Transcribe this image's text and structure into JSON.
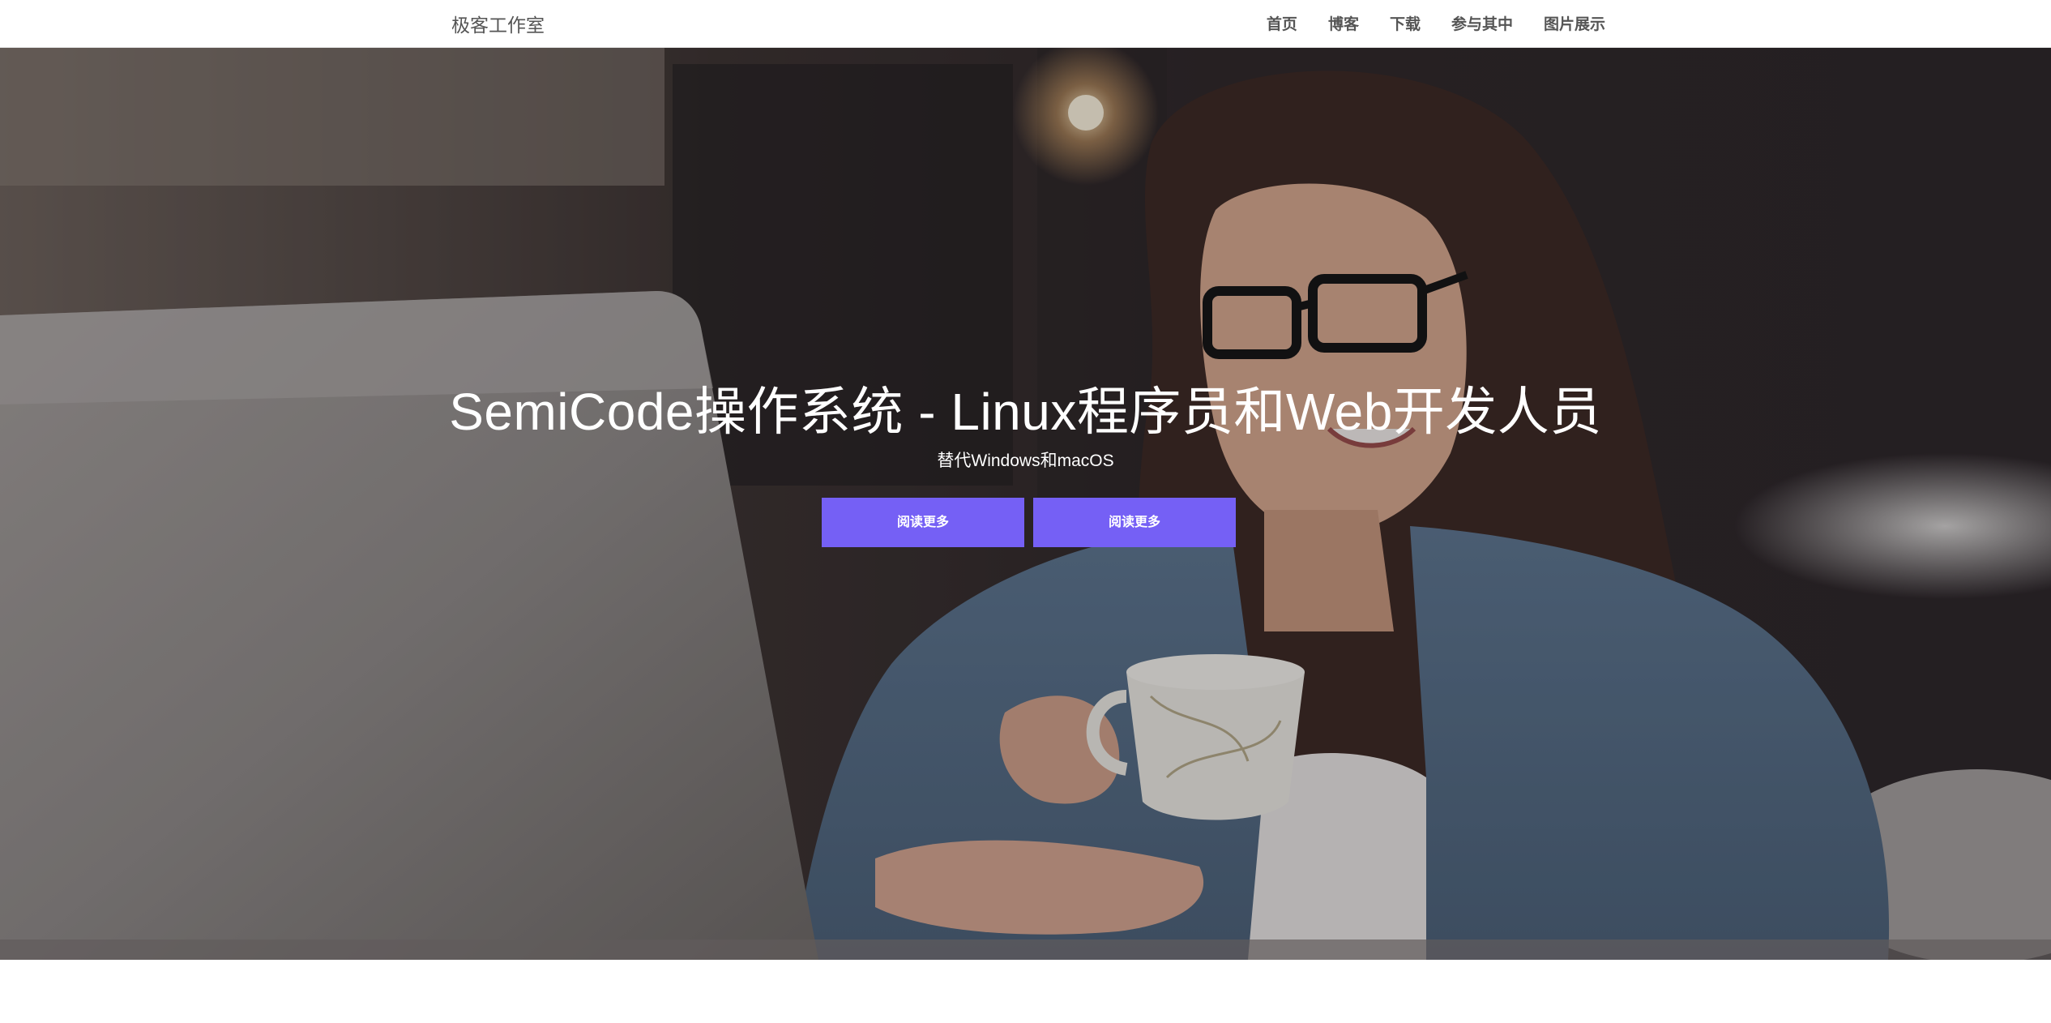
{
  "navbar": {
    "brand": "极客工作室",
    "links": [
      "首页",
      "博客",
      "下载",
      "参与其中",
      "图片展示"
    ]
  },
  "hero": {
    "title": "SemiCode操作系统 - Linux程序员和Web开发人员",
    "subtitle": "替代Windows和macOS",
    "buttons": [
      "阅读更多",
      "阅读更多"
    ],
    "background_image": "woman-with-glasses-smiling-at-laptop-holding-coffee-cup",
    "button_color": "#7560f5"
  }
}
